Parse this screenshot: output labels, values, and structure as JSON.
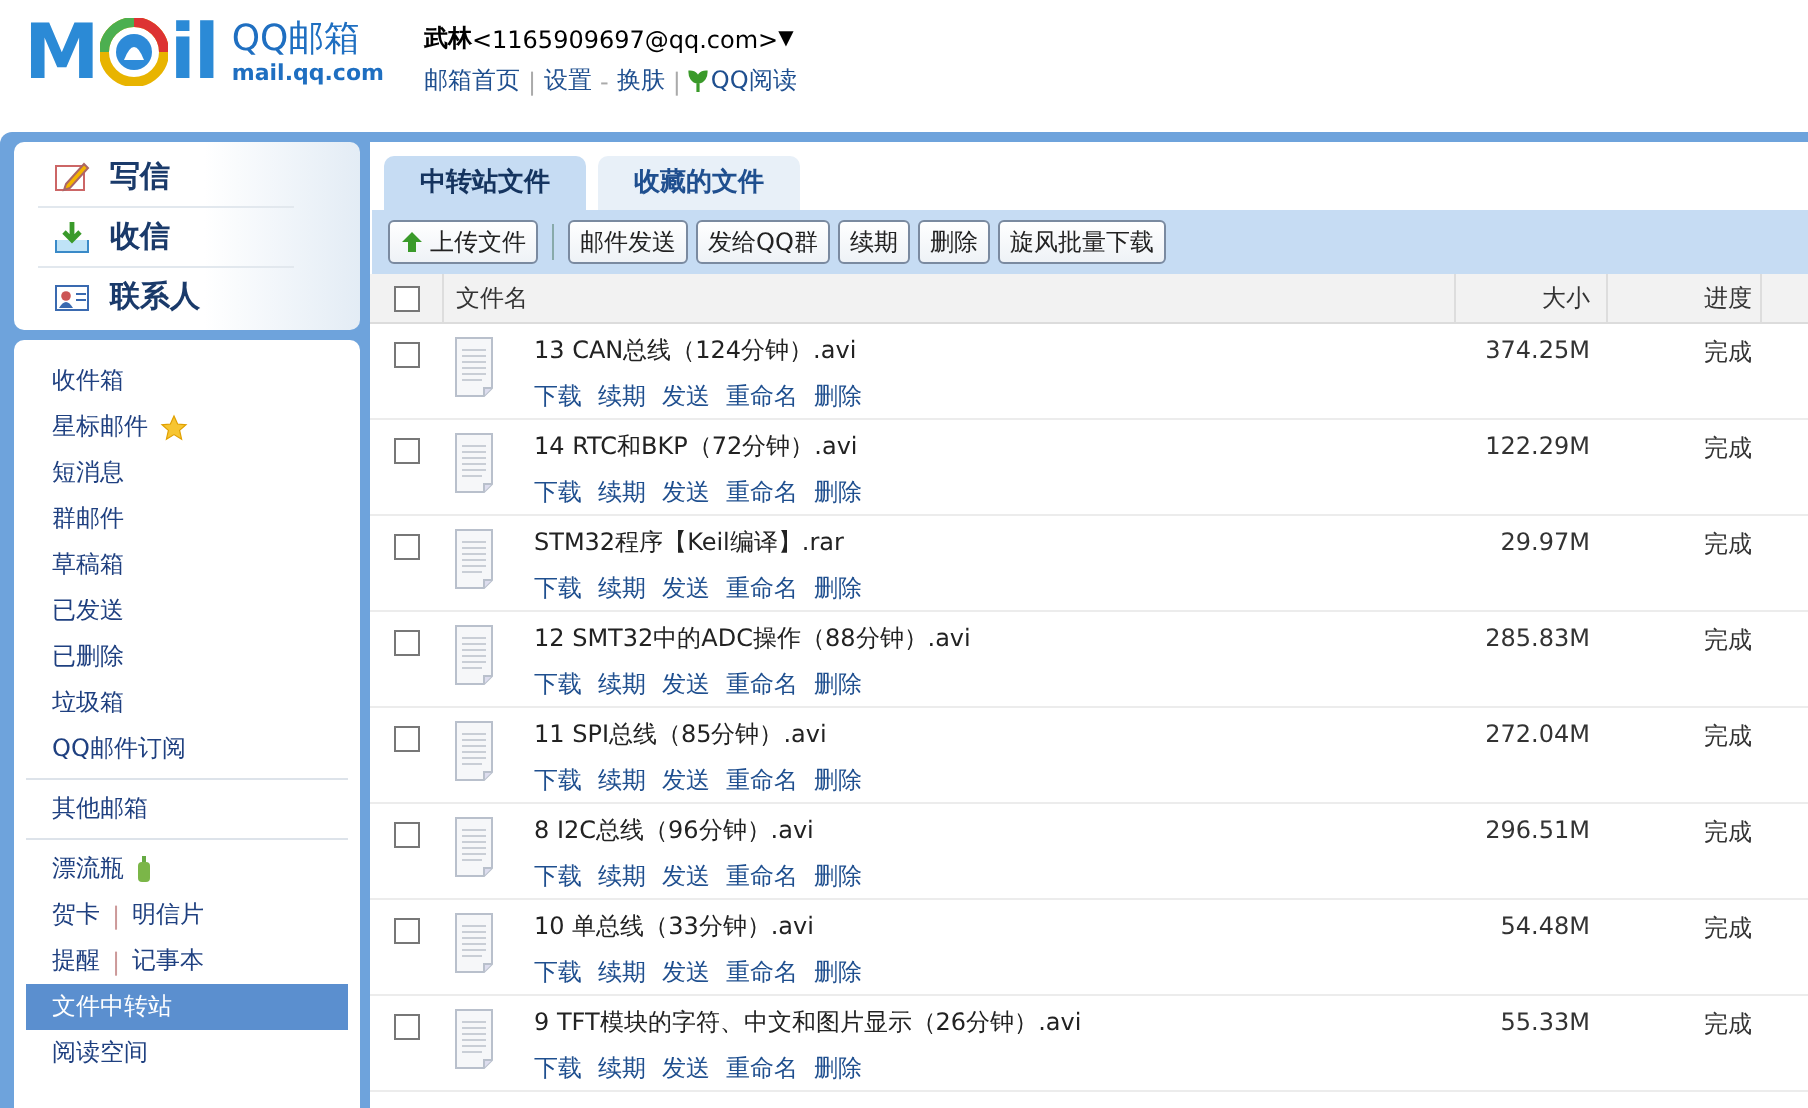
{
  "header": {
    "logo": {
      "before": "M",
      "after": "il",
      "brand": "QQ邮箱",
      "domain": "mail.qq.com"
    },
    "user": {
      "name": "武林",
      "email": "<1165909697@qq.com>",
      "caret": "▼"
    },
    "nav": [
      {
        "kind": "link",
        "label": "邮箱首页"
      },
      {
        "kind": "sep",
        "label": "|"
      },
      {
        "kind": "link",
        "label": "设置"
      },
      {
        "kind": "sep",
        "label": "-"
      },
      {
        "kind": "link",
        "label": "换肤"
      },
      {
        "kind": "sep",
        "label": "|"
      },
      {
        "kind": "reader",
        "label": "QQ阅读"
      }
    ]
  },
  "actions": [
    {
      "kind": "write",
      "label": "写信"
    },
    {
      "kind": "inbox",
      "label": "收信"
    },
    {
      "kind": "contacts",
      "label": "联系人"
    }
  ],
  "folders": [
    [
      {
        "links": [
          "收件箱"
        ],
        "selected": false
      },
      {
        "links": [
          "星标邮件"
        ],
        "kind": "starred",
        "selected": false
      },
      {
        "links": [
          "短消息"
        ],
        "selected": false
      },
      {
        "links": [
          "群邮件"
        ],
        "selected": false
      },
      {
        "links": [
          "草稿箱"
        ],
        "selected": false
      },
      {
        "links": [
          "已发送"
        ],
        "selected": false
      },
      {
        "links": [
          "已删除"
        ],
        "selected": false
      },
      {
        "links": [
          "垃圾箱"
        ],
        "selected": false
      },
      {
        "links": [
          "QQ邮件订阅"
        ],
        "selected": false
      }
    ],
    [
      {
        "links": [
          "其他邮箱"
        ],
        "selected": false
      }
    ],
    [
      {
        "links": [
          "漂流瓶"
        ],
        "kind": "bottle",
        "selected": false
      },
      {
        "links": [
          "贺卡",
          "明信片"
        ],
        "separator": "|",
        "selected": false
      },
      {
        "links": [
          "提醒",
          "记事本"
        ],
        "separator": "|",
        "selected": false
      },
      {
        "links": [
          "文件中转站"
        ],
        "selected": true
      },
      {
        "links": [
          "阅读空间"
        ],
        "selected": false
      }
    ]
  ],
  "tabs": [
    {
      "label": "中转站文件",
      "selected": true
    },
    {
      "label": "收藏的文件",
      "selected": false
    }
  ],
  "toolbar": [
    {
      "kind": "upload",
      "label": "上传文件"
    },
    {
      "kind": "plain",
      "label": "邮件发送"
    },
    {
      "kind": "plain",
      "label": "发给QQ群"
    },
    {
      "kind": "plain",
      "label": "续期"
    },
    {
      "kind": "plain",
      "label": "删除"
    },
    {
      "kind": "plain",
      "label": "旋风批量下载"
    }
  ],
  "table": {
    "columns": [
      "文件名",
      "大小",
      "进度"
    ],
    "select_all": {
      "checked": false
    },
    "rows": [
      {
        "name": "13 CAN总线（124分钟）.avi",
        "size": "374.25M",
        "progress": "完成",
        "complete": true,
        "checked": false,
        "actions": [
          "下载",
          "续期",
          "发送",
          "重命名",
          "删除"
        ]
      },
      {
        "name": "14 RTC和BKP（72分钟）.avi",
        "size": "122.29M",
        "progress": "完成",
        "complete": true,
        "checked": false,
        "actions": [
          "下载",
          "续期",
          "发送",
          "重命名",
          "删除"
        ]
      },
      {
        "name": "STM32程序【Keil编译】.rar",
        "size": "29.97M",
        "progress": "完成",
        "complete": true,
        "checked": false,
        "actions": [
          "下载",
          "续期",
          "发送",
          "重命名",
          "删除"
        ]
      },
      {
        "name": "12 SMT32中的ADC操作（88分钟）.avi",
        "size": "285.83M",
        "progress": "完成",
        "complete": true,
        "checked": false,
        "actions": [
          "下载",
          "续期",
          "发送",
          "重命名",
          "删除"
        ]
      },
      {
        "name": "11 SPI总线（85分钟）.avi",
        "size": "272.04M",
        "progress": "完成",
        "complete": true,
        "checked": false,
        "actions": [
          "下载",
          "续期",
          "发送",
          "重命名",
          "删除"
        ]
      },
      {
        "name": "8 I2C总线（96分钟）.avi",
        "size": "296.51M",
        "progress": "完成",
        "complete": true,
        "checked": false,
        "actions": [
          "下载",
          "续期",
          "发送",
          "重命名",
          "删除"
        ]
      },
      {
        "name": "10 单总线（33分钟）.avi",
        "size": "54.48M",
        "progress": "完成",
        "complete": true,
        "checked": false,
        "actions": [
          "下载",
          "续期",
          "发送",
          "重命名",
          "删除"
        ]
      },
      {
        "name": "9 TFT模块的字符、中文和图片显示（26分钟）.avi",
        "size": "55.33M",
        "progress": "完成",
        "complete": true,
        "checked": false,
        "actions": [
          "下载",
          "续期",
          "发送",
          "重命名",
          "删除"
        ]
      }
    ]
  }
}
